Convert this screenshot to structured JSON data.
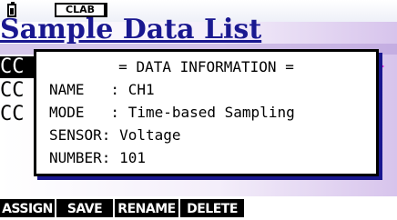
{
  "status_bar": {
    "battery_icon": "battery-icon",
    "mode_label": "CLAB"
  },
  "background": {
    "title": "Sample Data List",
    "rows": [
      "CC",
      "CC",
      "CC"
    ],
    "arrow_icon": "right-arrow-icon",
    "arrow_color": "#e010d0"
  },
  "dialog": {
    "title": "= DATA INFORMATION =",
    "name_line": "NAME   : CH1",
    "mode_line": "MODE   : Time-based Sampling",
    "sensor_line": "SENSOR: Voltage",
    "number_line": "NUMBER: 101"
  },
  "function_keys": {
    "f1": "ASSIGN",
    "f2": "SAVE",
    "f3": "RENAME",
    "f4": "DELETE"
  },
  "colors": {
    "title_color": "#1a1890",
    "accent_purple": "#b59ad8"
  }
}
